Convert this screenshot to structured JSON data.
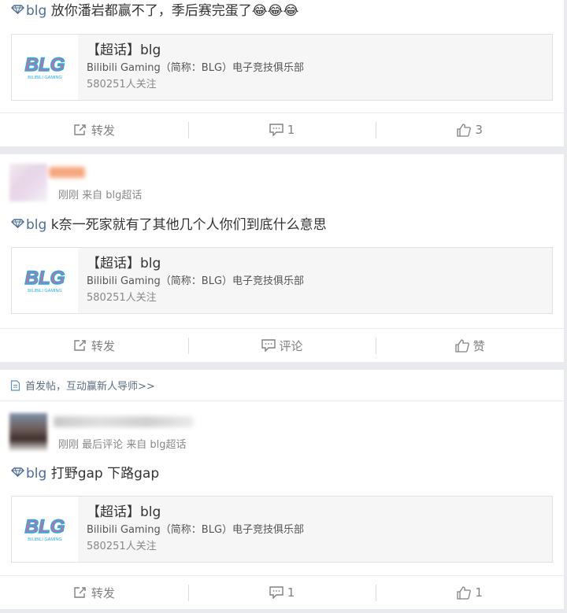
{
  "posts": [
    {
      "text": "放你潘岩都赢不了，季后赛完蛋了",
      "topic": "blg",
      "emoji": [
        "😂",
        "😂",
        "😂"
      ],
      "card": {
        "title": "【超话】blg",
        "desc": "Bilibili Gaming（简称：BLG）电子竞技俱乐部",
        "fans": "580251人关注",
        "logo_text": "BLG",
        "logo_sub": "BILIBILI GAMING"
      },
      "actions": {
        "repost": "转发",
        "comment": "1",
        "like": "3"
      }
    },
    {
      "user_sub": "刚刚 来自 blg超话",
      "text": "k奈一死家就有了其他几个人你们到底什么意思",
      "topic": "blg",
      "card": {
        "title": "【超话】blg",
        "desc": "Bilibili Gaming（简称：BLG）电子竞技俱乐部",
        "fans": "580251人关注",
        "logo_text": "BLG",
        "logo_sub": "BILIBILI GAMING"
      },
      "actions": {
        "repost": "转发",
        "comment": "评论",
        "like": "赞"
      }
    },
    {
      "user_sub": "刚刚 最后评论 来自 blg超话",
      "text": "打野gap 下路gap",
      "topic": "blg",
      "card": {
        "title": "【超话】blg",
        "desc": "Bilibili Gaming（简称：BLG）电子竞技俱乐部",
        "fans": "580251人关注",
        "logo_text": "BLG",
        "logo_sub": "BILIBILI GAMING"
      },
      "actions": {
        "repost": "转发",
        "comment": "1",
        "like": "1"
      }
    }
  ],
  "notice": "首发帖，互动赢新人导师>>",
  "colors": {
    "topic": "#4a6d9c",
    "logo_pink": "#f25d8e",
    "logo_cyan": "#23ade5"
  }
}
